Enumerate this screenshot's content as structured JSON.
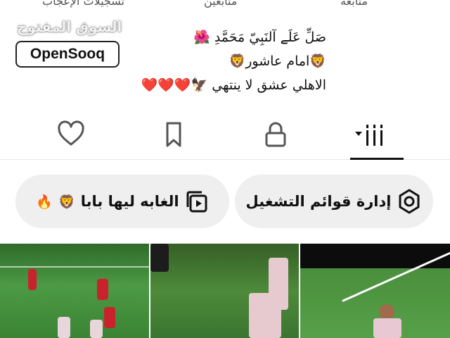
{
  "stats": {
    "following_label": "متابعة",
    "followers_label": "متابعين",
    "likes_label": "تسجيلات الإعجاب"
  },
  "watermark": "السوق المفتوح",
  "logo_text": "OpenSooq",
  "bio": {
    "line1": "صَلِّ عَلَے آلنَبِيّ مَحَمَّدِ",
    "line2": "امام عاشور",
    "line3": "الاهلي عشق لا ينتهي"
  },
  "tabs": [
    "videos-grid-icon",
    "lock-icon",
    "bookmark-icon",
    "heart-icon"
  ],
  "playlists": {
    "manage_label": "إدارة قوائم التشغيل",
    "playlist_label": "الغابه ليها بابا"
  },
  "colors": {
    "accent": "#111111",
    "pill_bg": "#efefef",
    "pitch": "#3f8a3a",
    "jersey_red": "#c8232c"
  }
}
